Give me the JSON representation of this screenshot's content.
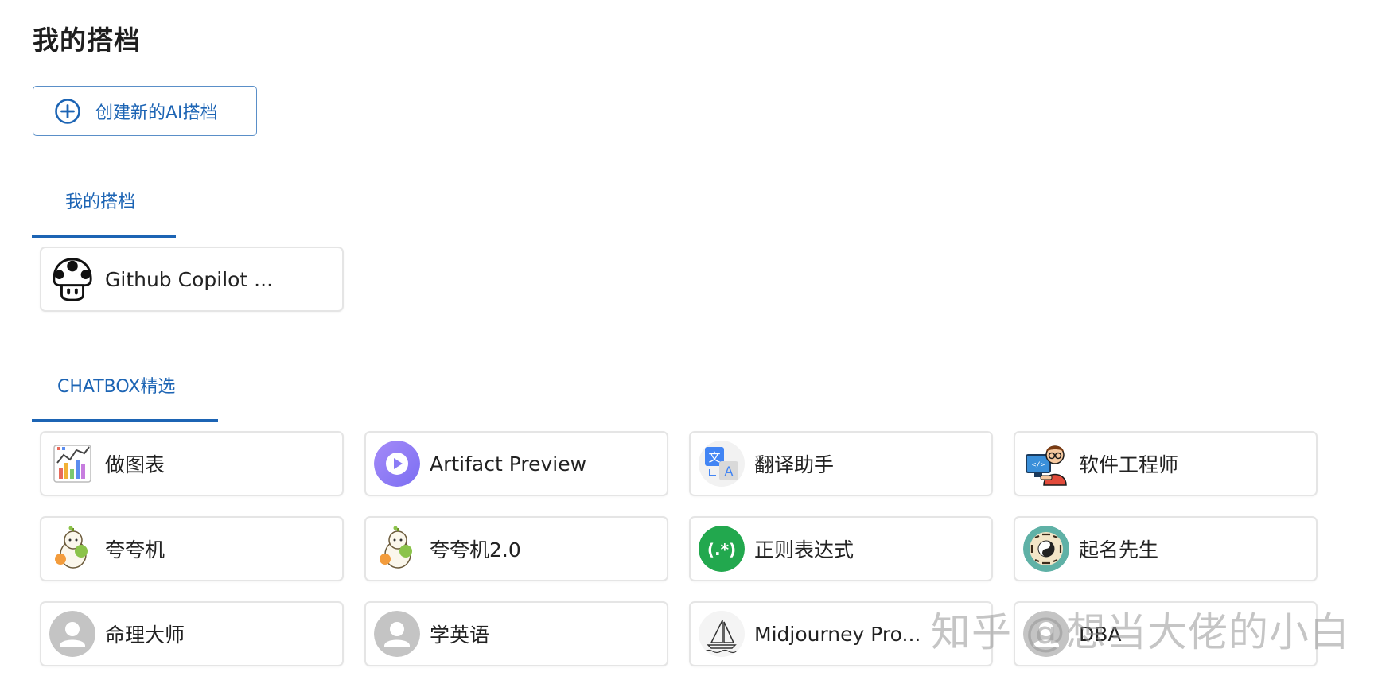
{
  "page": {
    "title": "我的搭档",
    "create_button_label": "创建新的AI搭档"
  },
  "tabs": {
    "my_partners": "我的搭档",
    "chatbox_picks": "CHATBOX精选"
  },
  "my_partners": [
    {
      "label": "Github Copilot ...",
      "icon": "mushroom-icon"
    }
  ],
  "chatbox_picks": [
    {
      "label": "做图表",
      "icon": "chart-icon"
    },
    {
      "label": "Artifact Preview",
      "icon": "play-icon"
    },
    {
      "label": "翻译助手",
      "icon": "translate-icon"
    },
    {
      "label": "软件工程师",
      "icon": "engineer-icon"
    },
    {
      "label": "夸夸机",
      "icon": "sheep-icon"
    },
    {
      "label": "夸夸机2.0",
      "icon": "sheep-icon"
    },
    {
      "label": "正则表达式",
      "icon": "regex-icon"
    },
    {
      "label": "起名先生",
      "icon": "bagua-icon"
    },
    {
      "label": "命理大师",
      "icon": "user-icon"
    },
    {
      "label": "学英语",
      "icon": "user-icon"
    },
    {
      "label": "Midjourney Pro...",
      "icon": "sailboat-icon"
    },
    {
      "label": "DBA",
      "icon": "user-icon"
    }
  ],
  "watermark": "知乎 @想当大佬的小白",
  "colors": {
    "accent": "#1c64b4",
    "card_border": "#e5e5e5",
    "regex_green": "#22a84e",
    "play_purple": "#8b7cf6"
  }
}
